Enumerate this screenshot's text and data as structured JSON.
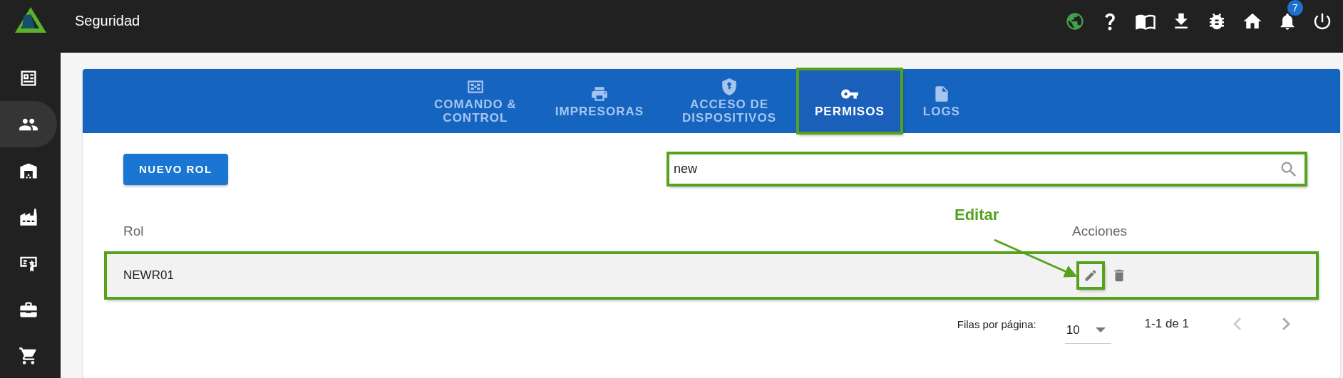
{
  "header": {
    "title": "Seguridad",
    "notification_count": "7"
  },
  "sidebar": {
    "items": [
      {
        "selected": false
      },
      {
        "selected": true
      },
      {
        "selected": false
      },
      {
        "selected": false
      },
      {
        "selected": false
      },
      {
        "selected": false
      },
      {
        "selected": false
      }
    ]
  },
  "tabs": [
    {
      "label": "COMANDO &\nCONTROL",
      "selected": false,
      "highlighted": false
    },
    {
      "label": "IMPRESORAS",
      "selected": false,
      "highlighted": false
    },
    {
      "label": "ACCESO DE\nDISPOSITIVOS",
      "selected": false,
      "highlighted": false
    },
    {
      "label": "PERMISOS",
      "selected": true,
      "highlighted": true
    },
    {
      "label": "LOGS",
      "selected": false,
      "highlighted": false
    }
  ],
  "toolbar": {
    "new_button": "NUEVO ROL",
    "search": {
      "value": "new",
      "highlighted": true
    }
  },
  "table": {
    "columns": [
      "Rol",
      "Acciones"
    ],
    "rows": [
      {
        "cells": [
          "NEWR01"
        ],
        "highlighted": true,
        "edit_highlighted": true
      }
    ]
  },
  "pagination": {
    "rows_per_page_label": "Filas por página:",
    "rows_per_page": "10",
    "range": "1-1 de 1"
  },
  "annotation": {
    "label": "Editar"
  }
}
